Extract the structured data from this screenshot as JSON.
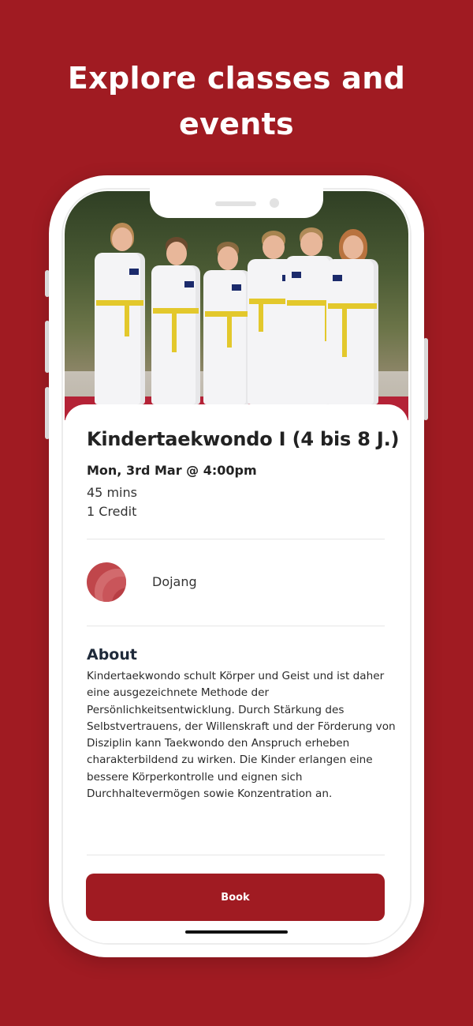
{
  "headline": {
    "line1": "Explore classes and",
    "line2": "events"
  },
  "class_detail": {
    "title": "Kindertaekwondo I (4 bis 8 J.)",
    "datetime": "Mon, 3rd Mar @ 4:00pm",
    "duration": "45 mins",
    "credits": "1 Credit",
    "location": {
      "name": "Dojang",
      "avatar_icon": "location-avatar-icon"
    },
    "about": {
      "heading": "About",
      "body": "Kindertaekwondo schult Körper und Geist und ist daher eine ausgezeichnete Methode der Persönlichkeitsentwicklung. Durch Stärkung des Selbstvertrauens, der Willenskraft und der Förderung von Disziplin kann Taekwondo den Anspruch erheben charakterbildend zu wirken. Die Kinder erlangen eine bessere Körperkontrolle und eignen sich Durchhaltevermögen sowie Konzentration an."
    },
    "book_label": "Book"
  },
  "colors": {
    "brand": "#a01b22",
    "text_dark": "#222222",
    "heading_navy": "#1f2a3a"
  }
}
